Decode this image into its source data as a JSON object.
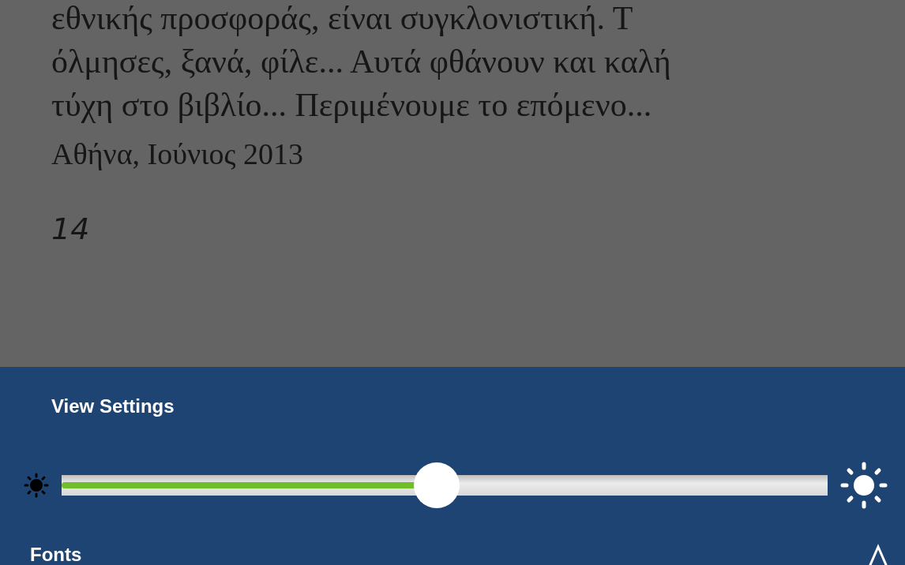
{
  "page": {
    "lines": [
      "εθνικής προσφοράς, είναι συγκλονιστική. Τ",
      "όλμησες, ξανά, φίλε... Αυτά φθάνουν και καλή",
      "τύχη στο βιβλίο... Περιμένουμε το επόμενο..."
    ],
    "signature": "Αθήνα, Ιούνιος 2013",
    "page_number": "14"
  },
  "view_settings": {
    "title": "View Settings",
    "brightness": {
      "level": 0.49
    },
    "fonts_label": "Fonts"
  }
}
